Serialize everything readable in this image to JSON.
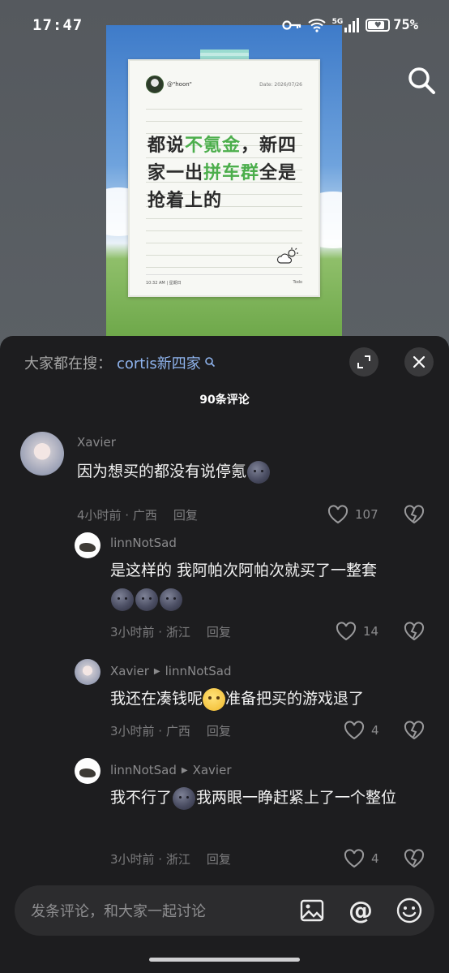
{
  "status_bar": {
    "time": "17:47",
    "network": "5G",
    "battery": "75%",
    "icons": [
      "key-icon",
      "wifi-icon",
      "signal-icon",
      "battery-icon"
    ]
  },
  "poster": {
    "username": "@\"hoon\"",
    "date": "Date: 2026/07/26",
    "text_parts": [
      {
        "t": "都说",
        "hl": false
      },
      {
        "t": "不氪金",
        "hl": true
      },
      {
        "t": "，新四家一出",
        "hl": false
      },
      {
        "t": "拼车群",
        "hl": true
      },
      {
        "t": "全是抢着上的",
        "hl": false
      }
    ],
    "footer_left": "10:32 AM  |  星期日",
    "footer_right": "Todo"
  },
  "comments_sheet": {
    "search_label": "大家都在搜：",
    "search_term": "cortis新四家",
    "count": "90条评论",
    "comments": [
      {
        "author": "Xavier",
        "text_before": "因为想买的都没有说停氪",
        "meta_time": "4小时前 · 广西",
        "reply": "回复",
        "likes": "107"
      },
      {
        "author": "linnNotSad",
        "text": "是这样的 我阿帕次阿帕次就买了一整套",
        "meta_time": "3小时前 · 浙江",
        "reply": "回复",
        "likes": "14"
      },
      {
        "author": "Xavier",
        "reply_to": "linnNotSad",
        "text_before": "我还在凑钱呢",
        "text_after": "准备把买的游戏退了",
        "meta_time": "3小时前 · 广西",
        "reply": "回复",
        "likes": "4"
      },
      {
        "author": "linnNotSad",
        "reply_to": "Xavier",
        "text_before": "我不行了",
        "text_after": "我两眼一睁赶紧上了一个整位",
        "meta_time": "3小时前 · 浙江",
        "reply": "回复",
        "likes": "4"
      }
    ],
    "input_placeholder": "发条评论，和大家一起讨论"
  },
  "colors": {
    "sheet_bg": "#1d1d1f",
    "search_term": "#8fb4ee",
    "highlight_green": "#4cae4c"
  }
}
